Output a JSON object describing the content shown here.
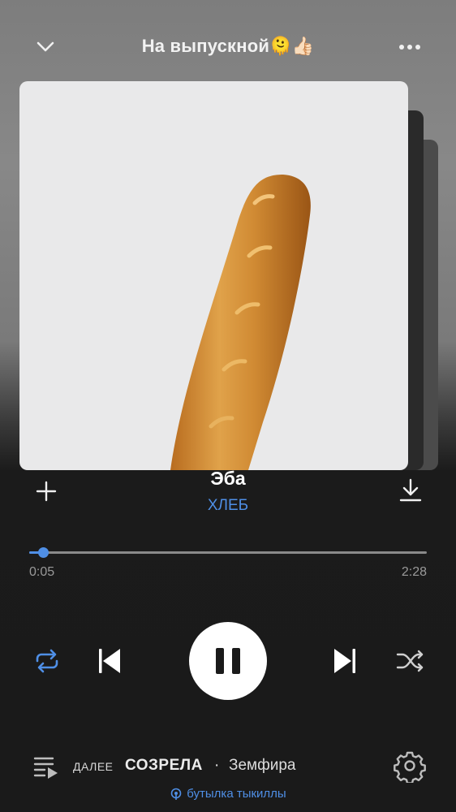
{
  "header": {
    "title": "На выпускной🫠👍🏻",
    "collapse_icon": "chevron-down-icon",
    "more_icon": "more-dots-icon"
  },
  "now_playing": {
    "title": "Эба",
    "artist": "ХЛЕБ",
    "cover_description_icon": "baguette-cover-art"
  },
  "progress": {
    "current": "0:05",
    "duration": "2:28",
    "fraction": 0.034
  },
  "controls": {
    "repeat_icon": "repeat-icon",
    "prev_icon": "skip-previous-icon",
    "pause_icon": "pause-icon",
    "next_icon": "skip-next-icon",
    "shuffle_icon": "shuffle-icon",
    "add_icon": "plus-icon",
    "download_icon": "download-icon"
  },
  "up_next": {
    "label": "ДАЛЕЕ",
    "song": "СОЗРЕЛА",
    "separator": "·",
    "artist": "Земфира",
    "queue_icon": "queue-icon",
    "settings_icon": "gear-icon"
  },
  "source": {
    "text": "бутылка тыкиллы",
    "icon": "broadcast-icon"
  },
  "colors": {
    "accent": "#4f8fe6",
    "background_dark": "#1a1a1a",
    "cover_bg": "#e9e9ea"
  }
}
